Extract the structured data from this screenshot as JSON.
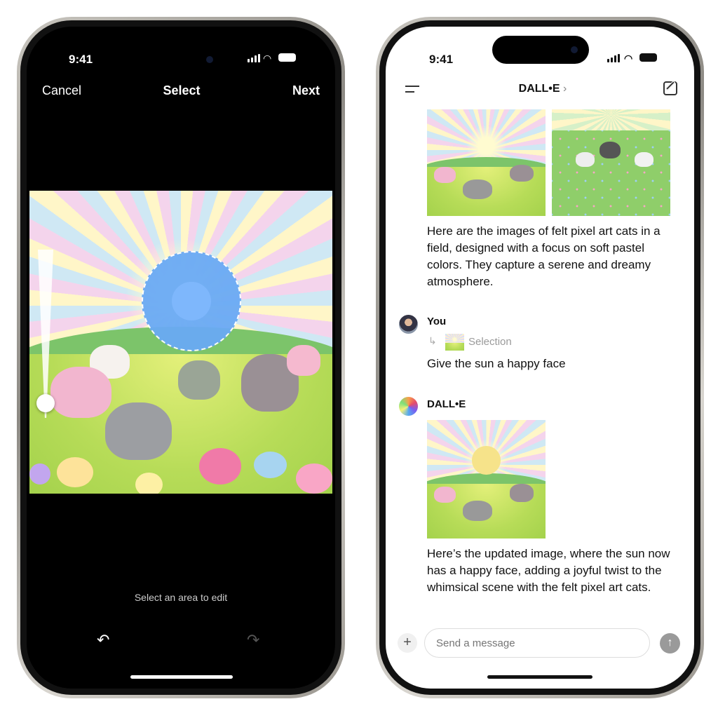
{
  "left_phone": {
    "status_time": "9:41",
    "nav": {
      "cancel": "Cancel",
      "title": "Select",
      "next": "Next"
    },
    "hint": "Select an area to edit",
    "brush_size_fraction": 0.9,
    "icons": [
      "undo-icon",
      "redo-icon",
      "signal-icon",
      "wifi-icon",
      "battery-icon"
    ]
  },
  "right_phone": {
    "status_time": "9:41",
    "header": {
      "title": "DALL•E",
      "chevron": "›"
    },
    "messages": [
      {
        "text": "Here are the images of felt pixel art cats in a field, designed with a focus on soft pastel colors. They capture a serene and dreamy atmosphere."
      },
      {
        "sender": "You",
        "reference": "Selection",
        "text": "Give the sun a happy face"
      },
      {
        "sender": "DALL•E",
        "text": "Here’s the updated image, where the sun now has a happy face, adding a joyful twist to the whimsical scene with the felt pixel art cats."
      }
    ],
    "composer": {
      "placeholder": "Send a message"
    },
    "colors": {
      "accent_gray": "#9a9a9a",
      "selection_blue": "#6aaaf5"
    }
  }
}
